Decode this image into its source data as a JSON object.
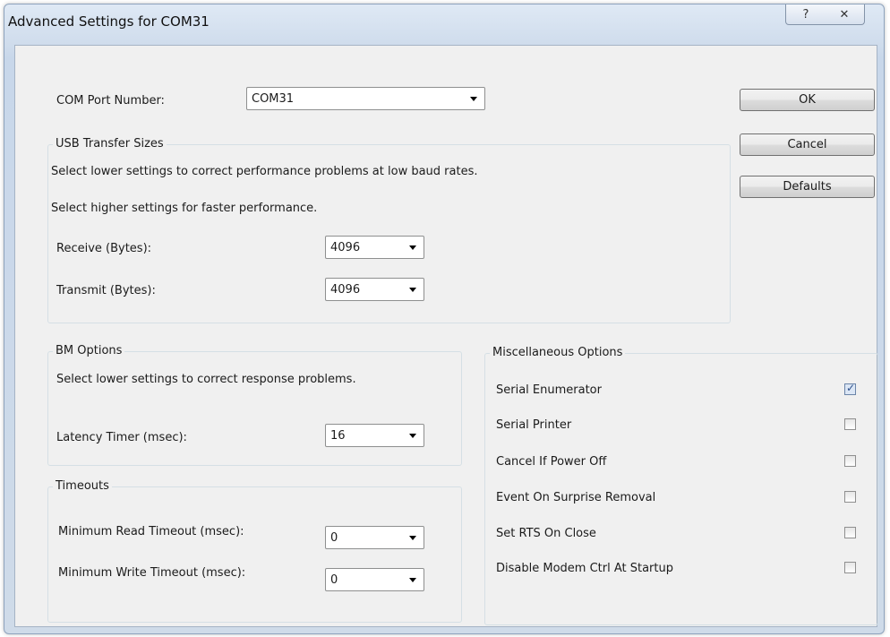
{
  "window": {
    "title": "Advanced Settings for COM31",
    "help_glyph": "?",
    "close_glyph": "✕"
  },
  "com_port": {
    "label": "COM Port Number:",
    "value": "COM31"
  },
  "usb_transfer": {
    "legend": "USB Transfer Sizes",
    "line1": "Select lower settings to correct performance problems at low baud rates.",
    "line2": "Select higher settings for faster performance.",
    "receive_label": "Receive (Bytes):",
    "receive_value": "4096",
    "transmit_label": "Transmit (Bytes):",
    "transmit_value": "4096"
  },
  "bm_options": {
    "legend": "BM Options",
    "desc": "Select lower settings to correct response problems.",
    "latency_label": "Latency Timer (msec):",
    "latency_value": "16"
  },
  "timeouts": {
    "legend": "Timeouts",
    "read_label": "Minimum Read Timeout (msec):",
    "read_value": "0",
    "write_label": "Minimum Write Timeout (msec):",
    "write_value": "0"
  },
  "misc": {
    "legend": "Miscellaneous Options",
    "options": [
      {
        "label": "Serial Enumerator",
        "checked": true
      },
      {
        "label": "Serial Printer",
        "checked": false
      },
      {
        "label": "Cancel If Power Off",
        "checked": false
      },
      {
        "label": "Event On Surprise Removal",
        "checked": false
      },
      {
        "label": "Set RTS On Close",
        "checked": false
      },
      {
        "label": "Disable Modem Ctrl At Startup",
        "checked": false
      }
    ],
    "check_glyph": "✓"
  },
  "buttons": {
    "ok": "OK",
    "cancel": "Cancel",
    "defaults": "Defaults"
  }
}
